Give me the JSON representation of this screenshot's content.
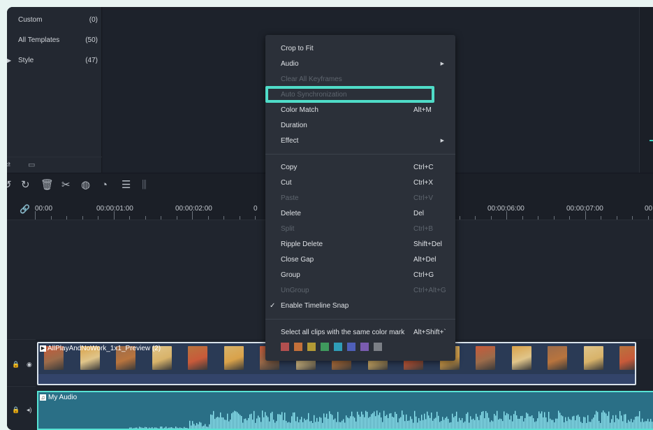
{
  "library": {
    "items": [
      {
        "label": "Custom",
        "count": "(0)",
        "has_arrow": false
      },
      {
        "label": "All Templates",
        "count": "(50)",
        "has_arrow": false
      },
      {
        "label": "Style",
        "count": "(47)",
        "has_arrow": true
      }
    ],
    "collapse_icon": "triangle-left-icon",
    "bottom_icons": [
      "link-folder-icon",
      "folder-icon"
    ]
  },
  "toolbar": {
    "icons": [
      "undo-icon",
      "redo-icon",
      "delete-icon",
      "cut-icon",
      "color-icon",
      "speed-icon",
      "adjust-icon",
      "audio-split-icon"
    ]
  },
  "ruler": {
    "labels": [
      "00:00",
      "00:00:01:00",
      "00:00:02:00",
      "0",
      "00:00:06:00",
      "00:00:07:00",
      "00"
    ]
  },
  "tracks": {
    "video": {
      "title": "AllPlayAndNoWork_1x1_Preview (2)"
    },
    "audio": {
      "title": "My Audio"
    }
  },
  "context_menu": {
    "group1": [
      {
        "label": "Crop to Fit",
        "shortcut": "",
        "submenu": false,
        "disabled": false
      },
      {
        "label": "Audio",
        "shortcut": "",
        "submenu": true,
        "disabled": false
      },
      {
        "label": "Clear All Keyframes",
        "shortcut": "",
        "submenu": false,
        "disabled": true
      },
      {
        "label": "Auto Synchronization",
        "shortcut": "",
        "submenu": false,
        "disabled": true
      },
      {
        "label": "Color Match",
        "shortcut": "Alt+M",
        "submenu": false,
        "disabled": false
      },
      {
        "label": "Duration",
        "shortcut": "",
        "submenu": false,
        "disabled": false
      },
      {
        "label": "Effect",
        "shortcut": "",
        "submenu": true,
        "disabled": false
      }
    ],
    "group2": [
      {
        "label": "Copy",
        "shortcut": "Ctrl+C",
        "disabled": false
      },
      {
        "label": "Cut",
        "shortcut": "Ctrl+X",
        "disabled": false
      },
      {
        "label": "Paste",
        "shortcut": "Ctrl+V",
        "disabled": true
      },
      {
        "label": "Delete",
        "shortcut": "Del",
        "disabled": false
      },
      {
        "label": "Split",
        "shortcut": "Ctrl+B",
        "disabled": true
      },
      {
        "label": "Ripple Delete",
        "shortcut": "Shift+Del",
        "disabled": false
      },
      {
        "label": "Close Gap",
        "shortcut": "Alt+Del",
        "disabled": false
      },
      {
        "label": "Group",
        "shortcut": "Ctrl+G",
        "disabled": false
      },
      {
        "label": "UnGroup",
        "shortcut": "Ctrl+Alt+G",
        "disabled": true
      },
      {
        "label": "Enable Timeline Snap",
        "shortcut": "",
        "disabled": false,
        "checked": true
      }
    ],
    "group3": [
      {
        "label": "Select all clips with the same color mark",
        "shortcut": "Alt+Shift+`",
        "disabled": false
      }
    ],
    "color_marks": [
      "#b24f4f",
      "#c4703a",
      "#b39a35",
      "#3f9a5d",
      "#2f9db7",
      "#4f5fb8",
      "#7a5cb0",
      "#7b7f86"
    ],
    "highlighted_item": "Auto Synchronization"
  },
  "colors": {
    "accent": "#4fdcc8",
    "panel_bg": "#1b1f27",
    "menu_bg": "#2b3039"
  }
}
